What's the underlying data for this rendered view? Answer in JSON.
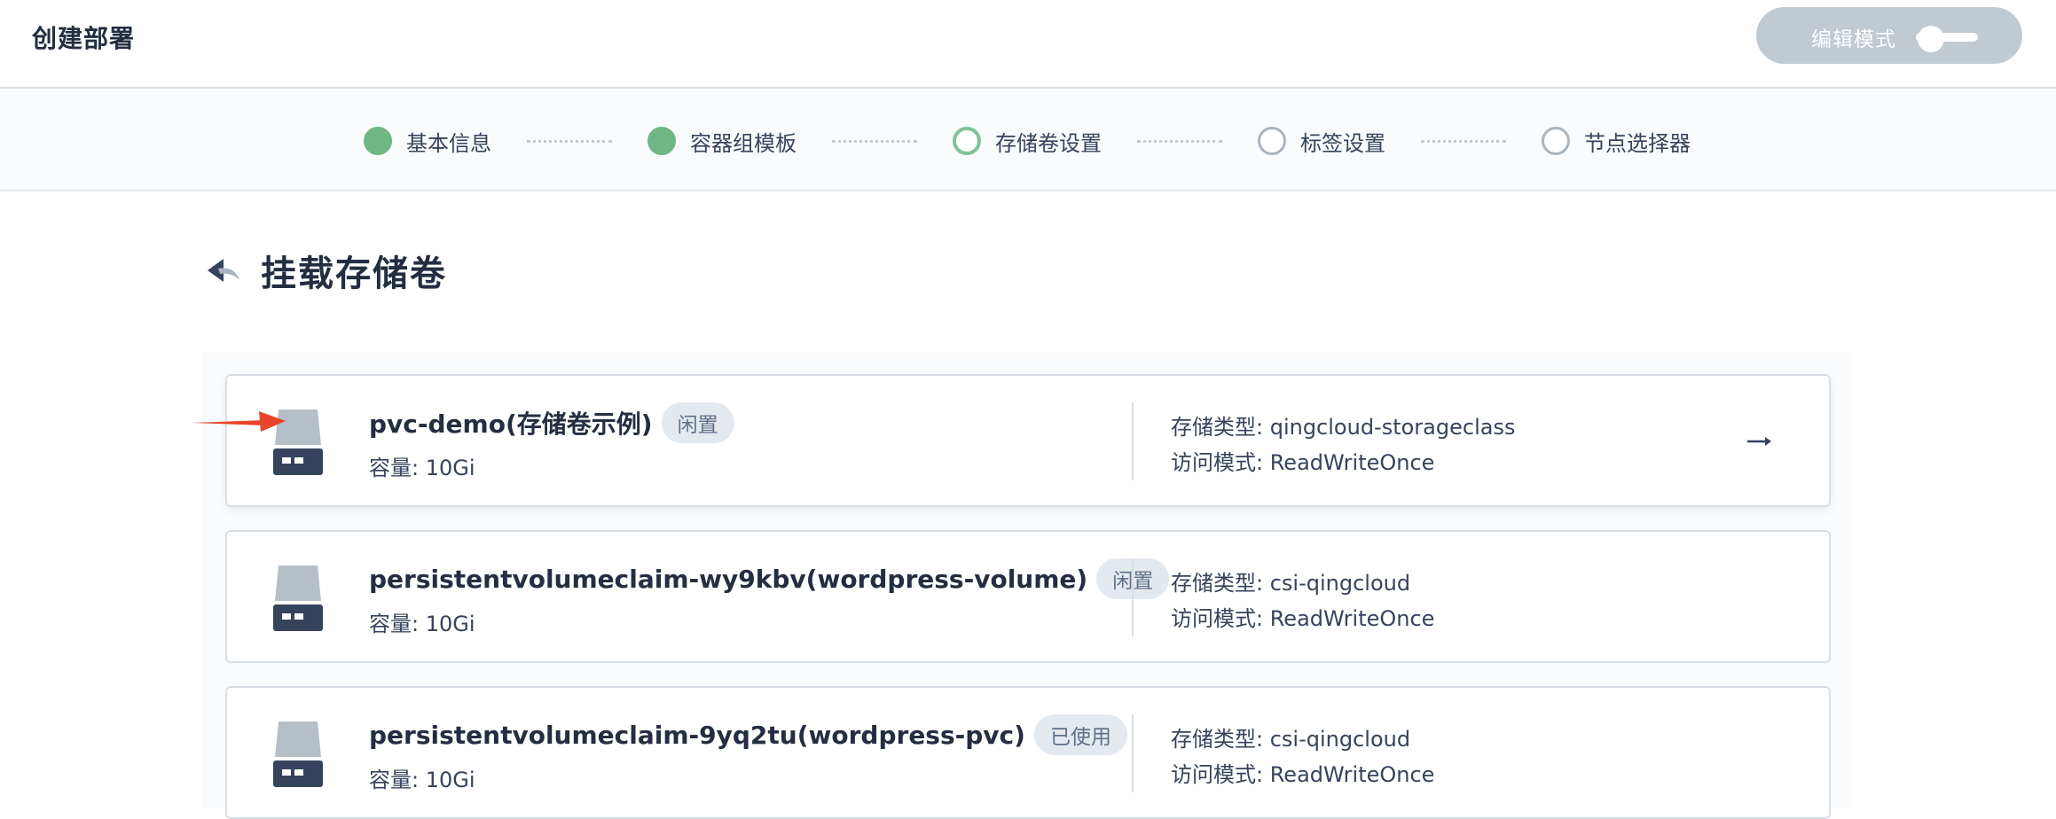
{
  "header": {
    "title": "创建部署",
    "edit_mode_label": "编辑模式"
  },
  "steps": [
    {
      "label": "基本信息",
      "state": "done"
    },
    {
      "label": "容器组模板",
      "state": "done"
    },
    {
      "label": "存储卷设置",
      "state": "active"
    },
    {
      "label": "标签设置",
      "state": "pending"
    },
    {
      "label": "节点选择器",
      "state": "pending"
    }
  ],
  "section": {
    "title": "挂载存储卷",
    "back_icon": "back-arrow-icon"
  },
  "volumes": [
    {
      "name": "pvc-demo(存储卷示例)",
      "status": "闲置",
      "capacity": "容量: 10Gi",
      "storage_class": "存储类型: qingcloud-storageclass",
      "access_mode": "访问模式: ReadWriteOnce"
    },
    {
      "name": "persistentvolumeclaim-wy9kbv(wordpress-volume)",
      "status": "闲置",
      "capacity": "容量: 10Gi",
      "storage_class": "存储类型: csi-qingcloud",
      "access_mode": "访问模式: ReadWriteOnce"
    },
    {
      "name": "persistentvolumeclaim-9yq2tu(wordpress-pvc)",
      "status": "已使用",
      "capacity": "容量: 10Gi",
      "storage_class": "存储类型: csi-qingcloud",
      "access_mode": "访问模式: ReadWriteOnce"
    }
  ],
  "colors": {
    "step_done": "#6fb785",
    "step_active": "#7fc29a",
    "annotation_arrow": "#e8442a",
    "disk_top": "#b6bec7",
    "disk_bottom": "#36435c"
  }
}
